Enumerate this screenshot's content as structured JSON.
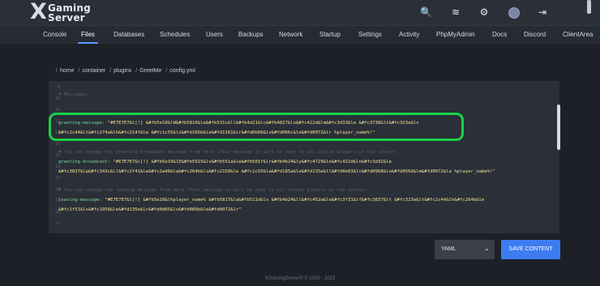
{
  "brand": {
    "mark": "X",
    "line1": "Gaming",
    "line2": "Server"
  },
  "top_icons": [
    {
      "name": "search-icon",
      "glyph": "🔍"
    },
    {
      "name": "layers-icon",
      "glyph": "≋"
    },
    {
      "name": "gears-icon",
      "glyph": "⚙"
    },
    {
      "name": "sign-out-icon",
      "glyph": "⇥"
    }
  ],
  "nav": {
    "tabs": [
      "Console",
      "Files",
      "Databases",
      "Schedules",
      "Users",
      "Backups",
      "Network",
      "Startup",
      "Settings",
      "Activity",
      "PhpMyAdmin",
      "Docs",
      "Discord",
      "ClientArea"
    ],
    "active": "Files"
  },
  "breadcrumb": {
    "sep": "/",
    "parts": [
      "home",
      "container",
      "plugins",
      "GreetMe",
      "config.yml"
    ]
  },
  "editor": {
    "line_numbers": [
      "9",
      "10",
      "11",
      "12",
      "13",
      "14",
      "15",
      "16",
      "17",
      "18",
      "19",
      "20",
      "21"
    ],
    "lines": [
      {
        "cmt": ""
      },
      {
        "cmt": "# Messages:"
      },
      {
        "cmt": "# ..."
      },
      {
        "cmt": ""
      },
      {
        "key": "greeting-message:",
        "val": "\"#E7E7E7&l[!] &#fb5e10&lW&#fb5816&le&#fb531c&ll&#fb4d21&lc&#fb4827&lo&#fc422d&lm&#fc3d33&le &#fc3738&lt&#fc323e&lo"
      },
      {
        "val": "&#fc2c44&lt&#fc274a&lh&#fc214f&le &#fc1c55&ls&#fd165b&le&#fd1161&lr&#fd0b66&lv&#fd066c&le&#fd0072&lr %player_name%!\""
      },
      {
        "cmt": "# You can change the greeting broadcast message from here (This message is will be sent to all online players on the server)"
      },
      {
        "key": "greeting-broadcast:",
        "val": "\"#E7E7E7&l[!] &#fb5e10&lE&#fb5915&lv&#fb551a&le&#fb501f&lr&#fb4b24&ly&#fc4729&lo&#fc422d&ln&#fc3d32&le"
      },
      {
        "val": "&#fc3837&lp&#fc343c&ll&#fc2f41&le&#fc2a46&la&#fc264b&ls&#fc2150&le &#fc1c55&la&#fd185a&le&#fd135e&ll&#fd0e63&lc&#fd0968&lo&#fd056d&lm&#fd0072&le %player_name%!\""
      },
      {
        "cmt": ""
      },
      {
        "cmt": "# You can change the leaving message from here (This message is will be sent to all online players on the server)"
      },
      {
        "key": "leaving-message:",
        "val": "\"#E7E7E7&l[!] &#fb5e10&l%player_name% &#fb5817&la&#fb511d&ls &#fb4b24&ll&#fc452a&le&#fc3f31&lf&#fc3837&lt &#fc323e&lt&#fc2c44&lh&#fc264b&le"
      },
      {
        "val": "&#fc1f51&ls&#fc1958&le&#fd135e&lr&#fd0d65&lv&#fd066b&le&#fd0072&lr\""
      }
    ]
  },
  "language_select": {
    "value": "YAML",
    "chevron": "⌄"
  },
  "save_button": {
    "label": "SAVE CONTENT"
  },
  "footer": {
    "text": "XGamingServer® © 2020 - 2023"
  },
  "colors": {
    "accent": "#3d7cf0",
    "highlight": "#17d249",
    "tab_underline": "#5b9bff"
  }
}
